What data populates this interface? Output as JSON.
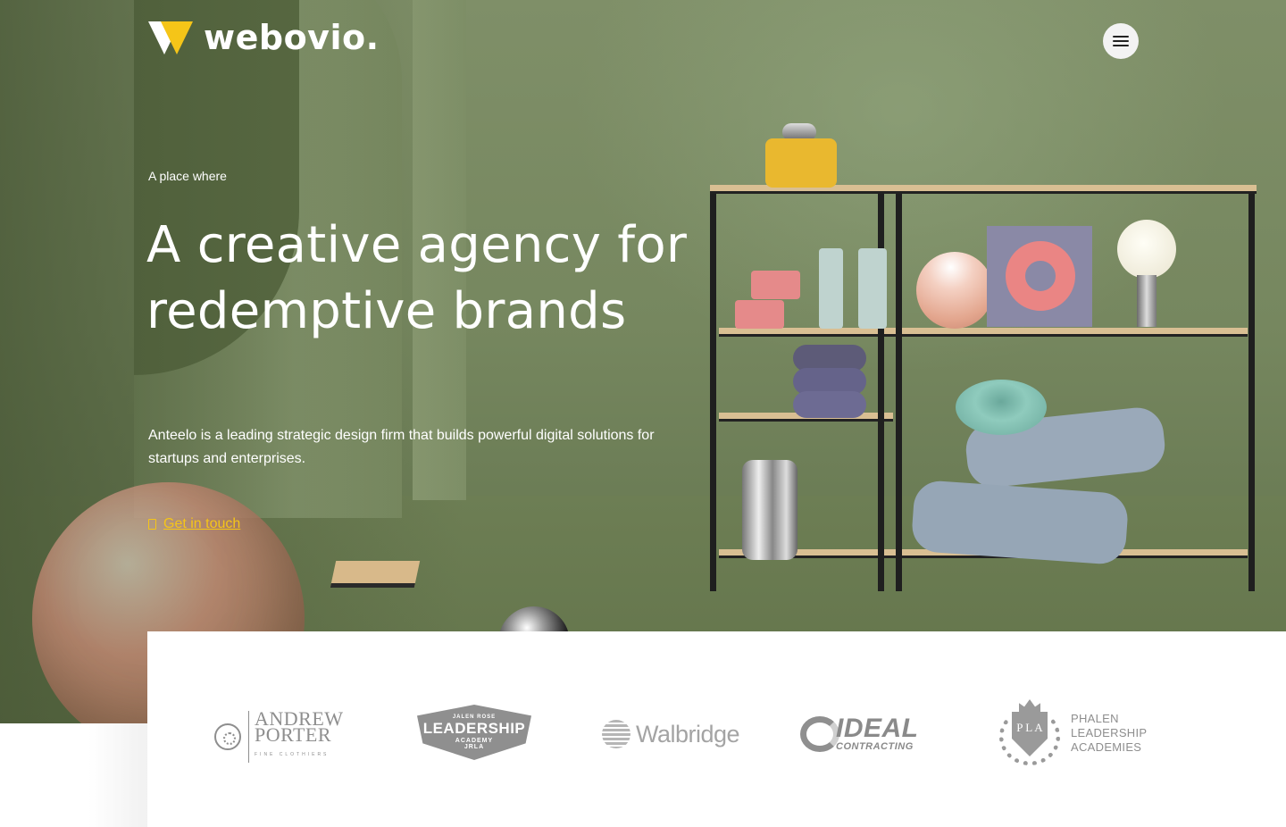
{
  "brand": {
    "name": "webovio.",
    "accent": "#f5c518"
  },
  "header": {
    "menu_icon": "hamburger-menu-icon"
  },
  "hero": {
    "eyebrow": "A place where",
    "headline_line1": "A creative agency for",
    "headline_line2": "redemptive brands",
    "lead": "Anteelo is a leading strategic design firm that builds powerful digital solutions for startups and enterprises.",
    "cta": {
      "icon": "phone-icon",
      "label": "Get in touch"
    }
  },
  "clients": {
    "andrew_porter": {
      "line1": "ANDREW",
      "line2": "PORTER",
      "sub": "FINE CLOTHIERS"
    },
    "jalen_rose": {
      "top": "JALEN ROSE",
      "main": "LEADERSHIP",
      "sub": "ACADEMY",
      "badge": "JRLA"
    },
    "walbridge": {
      "name": "Walbridge"
    },
    "ideal": {
      "main": "IDEAL",
      "sub": "CONTRACTING"
    },
    "phalen": {
      "letters": "P L A",
      "line1": "PHALEN",
      "line2": "LEADERSHIP",
      "line3": "ACADEMIES"
    }
  }
}
